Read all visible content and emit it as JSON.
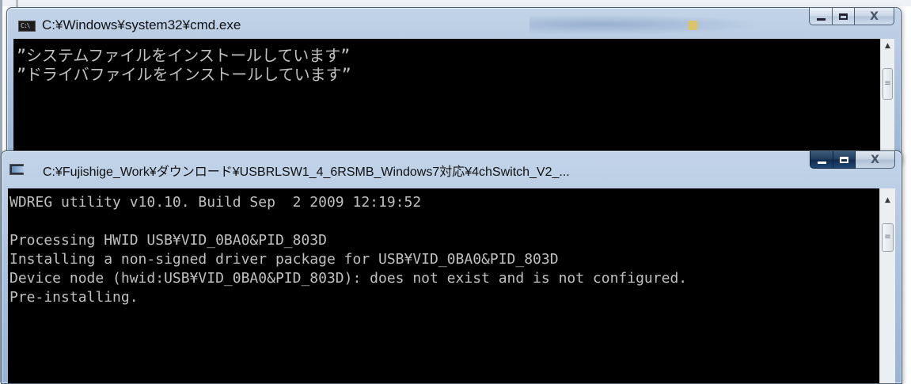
{
  "window1": {
    "title": "C:¥Windows¥system32¥cmd.exe",
    "icon_label": "C:\\",
    "icon": "cmd-icon",
    "lines": [
      "”システムファイルをインストールしています”",
      "”ドライバファイルをインストールしています”"
    ],
    "caption": {
      "minimize": "minimize-icon",
      "maximize": "maximize-icon",
      "close_glyph": "X"
    }
  },
  "window2": {
    "title": "C:¥Fujishige_Work¥ダウンロード¥USBRLSW1_4_6RSMB_Windows7対応¥4chSwitch_V2_...",
    "icon": "console-app-icon",
    "lines": [
      "WDREG utility v10.10. Build Sep  2 2009 12:19:52",
      "",
      "Processing HWID USB¥VID_0BA0&PID_803D",
      "Installing a non-signed driver package for USB¥VID_0BA0&PID_803D",
      "Device node (hwid:USB¥VID_0BA0&PID_803D): does not exist and is not configured.",
      "Pre-installing."
    ],
    "caption": {
      "minimize": "minimize-icon",
      "maximize": "maximize-icon",
      "close_glyph": "X"
    }
  },
  "colors": {
    "console_bg": "#000000",
    "console_text": "#c0c0c0",
    "titlebar": "#a6bfdc"
  }
}
